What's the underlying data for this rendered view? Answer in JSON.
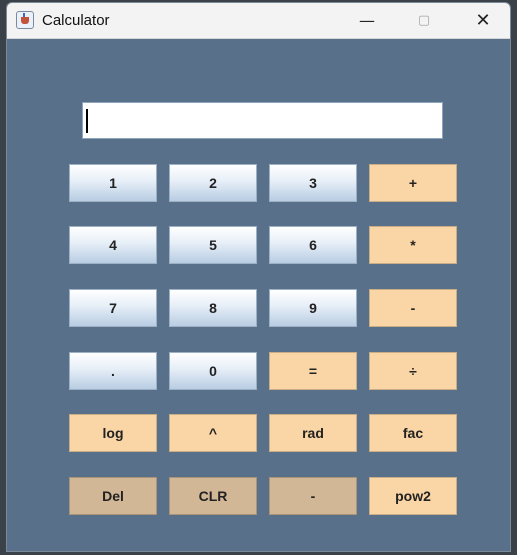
{
  "window": {
    "title": "Calculator",
    "icon": "java-cup-icon"
  },
  "controls": {
    "minimize": "—",
    "maximize": "▢",
    "close": "✕"
  },
  "display": {
    "value": ""
  },
  "keys": {
    "r1": [
      "1",
      "2",
      "3",
      "+"
    ],
    "r2": [
      "4",
      "5",
      "6",
      "*"
    ],
    "r3": [
      "7",
      "8",
      "9",
      "-"
    ],
    "r4": [
      ".",
      "0",
      "=",
      "÷"
    ],
    "r5": [
      "log",
      "^",
      "rad",
      "fac"
    ],
    "r6": [
      "Del",
      "CLR",
      "-",
      "pow2"
    ]
  },
  "colors": {
    "background": "#587089",
    "number_key": "#dce7f3",
    "operator_key": "#fad5a5",
    "edit_key": "#d2b797"
  }
}
